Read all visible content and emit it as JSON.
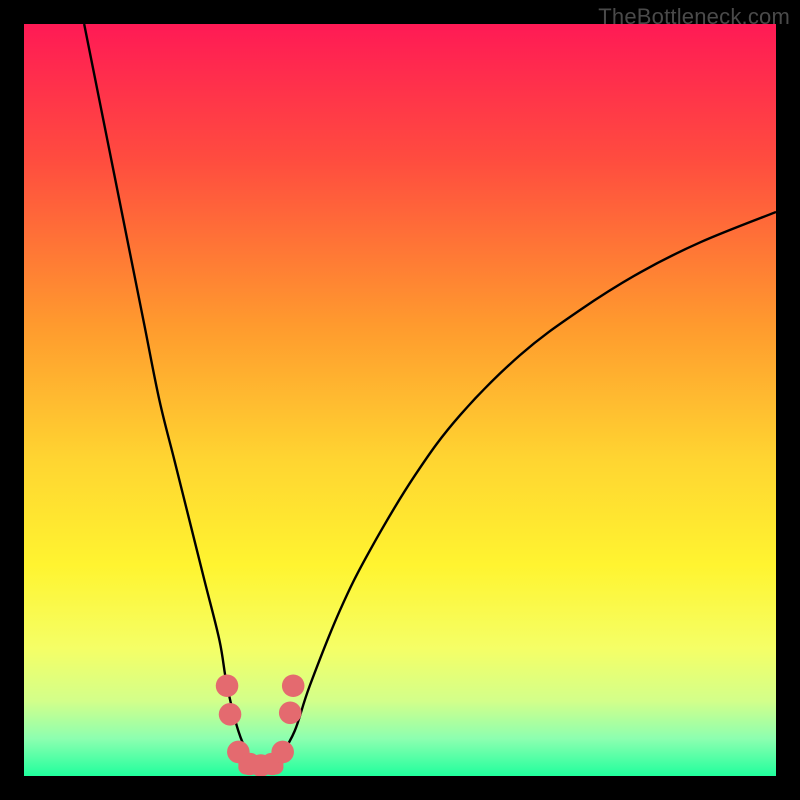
{
  "watermark": "TheBottleneck.com",
  "chart_data": {
    "type": "line",
    "title": "",
    "xlabel": "",
    "ylabel": "",
    "xlim": [
      0,
      100
    ],
    "ylim": [
      0,
      100
    ],
    "gradient_stops": [
      {
        "offset": 0.0,
        "color": "#ff1a55"
      },
      {
        "offset": 0.18,
        "color": "#ff4c3f"
      },
      {
        "offset": 0.4,
        "color": "#ff9a2e"
      },
      {
        "offset": 0.58,
        "color": "#ffd531"
      },
      {
        "offset": 0.72,
        "color": "#fff430"
      },
      {
        "offset": 0.83,
        "color": "#f5ff66"
      },
      {
        "offset": 0.9,
        "color": "#d3ff8a"
      },
      {
        "offset": 0.95,
        "color": "#8dffb0"
      },
      {
        "offset": 1.0,
        "color": "#20ff9d"
      }
    ],
    "series": [
      {
        "name": "bottleneck-curve",
        "x": [
          8,
          10,
          12,
          14,
          16,
          18,
          20,
          22,
          24,
          26,
          27,
          28.5,
          30,
          31,
          32,
          33,
          34,
          36,
          38,
          42,
          46,
          52,
          58,
          66,
          74,
          82,
          90,
          100
        ],
        "y": [
          100,
          90,
          80,
          70,
          60,
          50,
          42,
          34,
          26,
          18,
          12,
          6,
          2.5,
          1.4,
          1.2,
          1.4,
          2.5,
          6,
          12,
          22,
          30,
          40,
          48,
          56,
          62,
          67,
          71,
          75
        ]
      }
    ],
    "markers": {
      "name": "highlight-dots",
      "color": "#e46a6f",
      "radius_pct": 1.5,
      "points": [
        {
          "x": 27.0,
          "y": 12.0
        },
        {
          "x": 27.4,
          "y": 8.2
        },
        {
          "x": 28.5,
          "y": 3.2
        },
        {
          "x": 30.0,
          "y": 1.6
        },
        {
          "x": 31.5,
          "y": 1.4
        },
        {
          "x": 33.0,
          "y": 1.6
        },
        {
          "x": 34.4,
          "y": 3.2
        },
        {
          "x": 35.4,
          "y": 8.4
        },
        {
          "x": 35.8,
          "y": 12.0
        }
      ]
    },
    "trough_band": {
      "y": 1.2,
      "x_start": 29.5,
      "x_end": 33.5,
      "color": "#e46a6f",
      "thickness_pct": 2.0
    }
  }
}
